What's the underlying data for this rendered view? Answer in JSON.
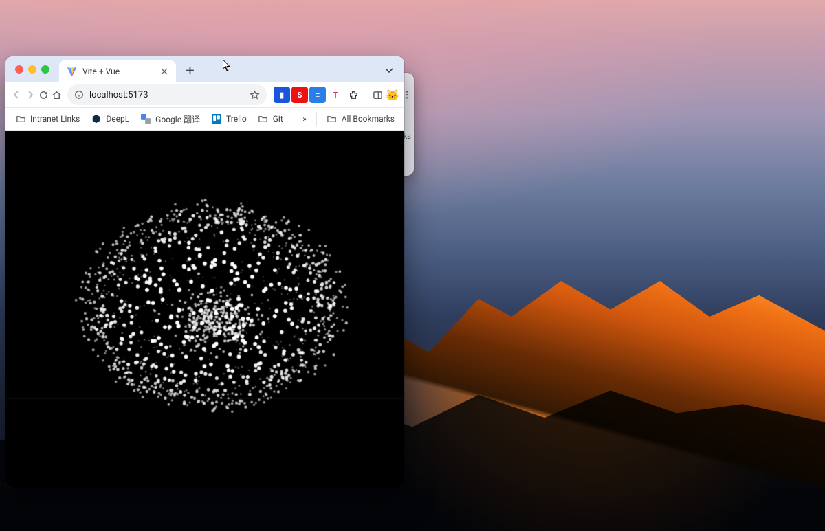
{
  "browser": {
    "tab": {
      "title": "Vite + Vue"
    },
    "toolbar": {
      "url": "localhost:5173"
    },
    "extensions": [
      {
        "name": "ext-blue-doc",
        "bg": "#1a56db",
        "glyph": "▮"
      },
      {
        "name": "ext-red-s",
        "bg": "#e11",
        "glyph": "S"
      },
      {
        "name": "ext-blue-lines",
        "bg": "#2b7de9",
        "glyph": "≡"
      },
      {
        "name": "ext-pink-t",
        "bg": "#ffffff",
        "fg": "#d63384",
        "glyph": "T"
      },
      {
        "name": "ext-puzzle",
        "bg": "#ffffff",
        "fg": "#333",
        "glyph": "✱"
      }
    ],
    "side_panel_icon": "▣",
    "profile_emoji": "🐱",
    "bookmarks": [
      {
        "icon": "folder",
        "label": "Intranet Links"
      },
      {
        "icon": "deepl",
        "label": "DeepL"
      },
      {
        "icon": "gtrans",
        "label": "Google 翻译"
      },
      {
        "icon": "trello",
        "label": "Trello"
      },
      {
        "icon": "folder",
        "label": "Git"
      }
    ],
    "bookmarks_overflow": "»",
    "all_bookmarks_label": "All Bookmarks"
  },
  "behind_window": {
    "chevron": "⌄",
    "label": "ks"
  }
}
